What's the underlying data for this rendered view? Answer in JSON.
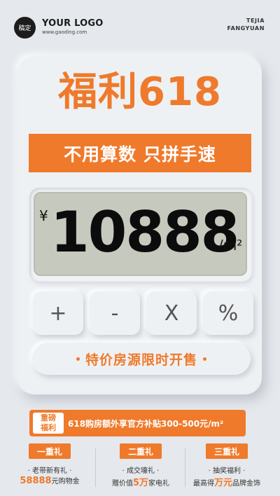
{
  "header": {
    "logo_badge": "稿定",
    "logo_name": "YOUR LOGO",
    "logo_url": "www.gaoding.com",
    "brand_line1": "TEJIA",
    "brand_line2": "FANGYUAN"
  },
  "card": {
    "headline": "福利618",
    "banner": "不用算数 只拼手速",
    "display": {
      "currency": "¥",
      "amount": "10888",
      "unit": "/m²"
    },
    "keys": [
      "+",
      "-",
      "X",
      "%"
    ],
    "sale_button": "特价房源限时开售"
  },
  "promo": {
    "tag_line1": "重磅",
    "tag_line2": "福利",
    "text": "618购房额外享官方补贴300-500元/m²"
  },
  "gifts": [
    {
      "tag": "一重礼",
      "desc": "· 老带新有礼 ·",
      "value_pre": "",
      "value_hl": "58888",
      "value_post": "元购物金"
    },
    {
      "tag": "二重礼",
      "desc": "· 成交壕礼 ·",
      "value_pre": "赠价值",
      "value_hl": "5万",
      "value_post": "家电礼"
    },
    {
      "tag": "三重礼",
      "desc": "· 抽奖福利 ·",
      "value_pre": "最高得",
      "value_hl": "万元",
      "value_post": "品牌金饰"
    }
  ],
  "colors": {
    "accent": "#ef7a2b",
    "background": "#e5e8ec",
    "display": "#c6c9bd"
  }
}
